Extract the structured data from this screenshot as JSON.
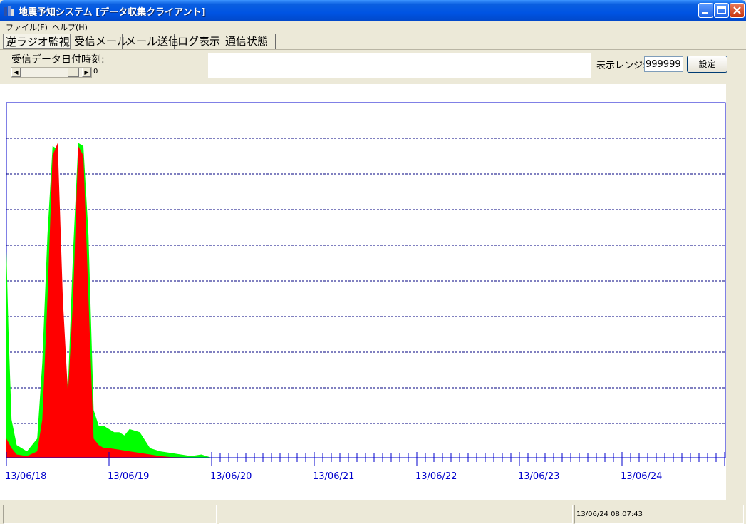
{
  "window": {
    "title": "地震予知システム [データ収集クライアント]"
  },
  "menu": [
    "ファイル(F)",
    "ヘルプ(H)"
  ],
  "tabs": [
    "逆ラジオ監視",
    "受信メール",
    "メール送信",
    "ログ表示",
    "通信状態"
  ],
  "controls": {
    "date_label": "受信データ日付時刻:",
    "scroll_value": "0",
    "range_label": "表示レンジ:",
    "range_value": "999999",
    "set_button": "設定"
  },
  "status": {
    "timestamp": "13/06/24 08:07:43"
  },
  "chart_data": {
    "type": "area",
    "x_tick_labels": [
      "13/06/18",
      "13/06/19",
      "13/06/20",
      "13/06/21",
      "13/06/22",
      "13/06/23",
      "13/06/24"
    ],
    "ylim": [
      0,
      999999
    ],
    "grid": true,
    "colors": {
      "series_a": "#00ff00",
      "series_b": "#ff0000",
      "grid": "#000080",
      "axis": "#0000cc",
      "tick_label": "#0000cc"
    },
    "series": [
      {
        "color": "#00ff00",
        "x_days": [
          0,
          0.02,
          0.05,
          0.1,
          0.2,
          0.3,
          0.35,
          0.4,
          0.45,
          0.5,
          0.55,
          0.6,
          0.65,
          0.7,
          0.75,
          0.8,
          0.85,
          0.9,
          0.95,
          1.0,
          1.05,
          1.1,
          1.15,
          1.2,
          1.3,
          1.4,
          1.5,
          1.6,
          1.7,
          1.8,
          1.9,
          2.0
        ],
        "y": [
          650000,
          400000,
          120000,
          40000,
          20000,
          60000,
          300000,
          700000,
          980000,
          970000,
          400000,
          220000,
          650000,
          990000,
          980000,
          700000,
          150000,
          100000,
          100000,
          90000,
          80000,
          80000,
          70000,
          90000,
          80000,
          30000,
          20000,
          15000,
          10000,
          5000,
          10000,
          0
        ]
      },
      {
        "color": "#ff0000",
        "x_days": [
          0,
          0.05,
          0.1,
          0.2,
          0.3,
          0.35,
          0.4,
          0.45,
          0.5,
          0.55,
          0.6,
          0.65,
          0.7,
          0.75,
          0.8,
          0.85,
          0.9,
          0.95,
          1.0,
          1.1,
          1.2,
          1.3,
          1.4,
          1.5,
          1.6,
          2.0
        ],
        "y": [
          60000,
          30000,
          10000,
          5000,
          20000,
          120000,
          500000,
          950000,
          990000,
          500000,
          200000,
          500000,
          980000,
          950000,
          500000,
          60000,
          40000,
          30000,
          30000,
          25000,
          20000,
          15000,
          10000,
          5000,
          2000,
          0
        ]
      }
    ]
  }
}
